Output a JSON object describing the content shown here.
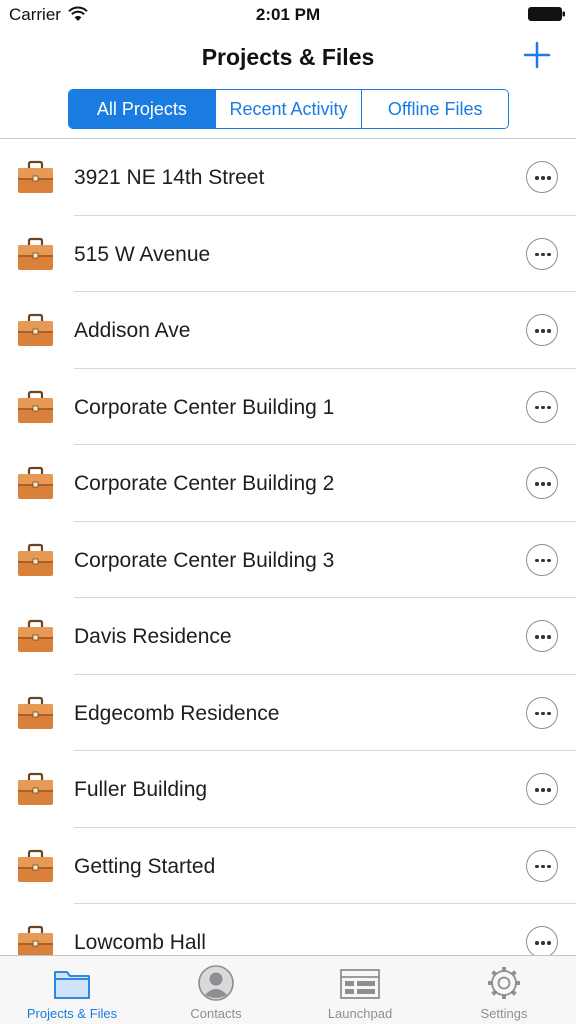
{
  "status_bar": {
    "carrier": "Carrier",
    "time": "2:01 PM"
  },
  "nav": {
    "title": "Projects & Files",
    "add_icon": "plus-icon"
  },
  "segments": [
    {
      "label": "All Projects",
      "active": true
    },
    {
      "label": "Recent Activity",
      "active": false
    },
    {
      "label": "Offline Files",
      "active": false
    }
  ],
  "projects": [
    {
      "name": "3921 NE 14th Street"
    },
    {
      "name": "515 W Avenue"
    },
    {
      "name": "Addison Ave"
    },
    {
      "name": "Corporate Center Building 1"
    },
    {
      "name": "Corporate Center Building 2"
    },
    {
      "name": "Corporate Center Building 3"
    },
    {
      "name": "Davis Residence"
    },
    {
      "name": "Edgecomb Residence"
    },
    {
      "name": "Fuller Building"
    },
    {
      "name": "Getting Started"
    },
    {
      "name": "Lowcomb Hall"
    }
  ],
  "tabs": [
    {
      "label": "Projects & Files",
      "icon": "folder-icon",
      "active": true
    },
    {
      "label": "Contacts",
      "icon": "contact-icon",
      "active": false
    },
    {
      "label": "Launchpad",
      "icon": "launchpad-icon",
      "active": false
    },
    {
      "label": "Settings",
      "icon": "gear-icon",
      "active": false
    }
  ],
  "colors": {
    "accent": "#1a7be0",
    "briefcase": "#d9803a",
    "inactive": "#8e8e93"
  }
}
